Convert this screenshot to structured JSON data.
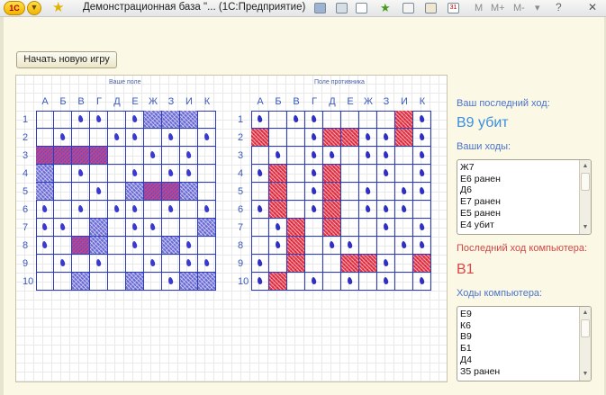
{
  "window": {
    "logo_text": "1С",
    "title": "Демонстрационная база \"...  (1С:Предприятие)",
    "menu_m": "M",
    "menu_mplus": "M+",
    "menu_mminus": "M-",
    "menu_caret": "▾",
    "help": "?",
    "close": "✕"
  },
  "toolbar": {
    "new_game_label": "Начать новую игру"
  },
  "player_field": {
    "label": "Ваше поле"
  },
  "enemy_field": {
    "label": "Поле противника"
  },
  "columns": [
    "А",
    "Б",
    "В",
    "Г",
    "Д",
    "Е",
    "Ж",
    "З",
    "И",
    "К"
  ],
  "rows": [
    "1",
    "2",
    "3",
    "4",
    "5",
    "6",
    "7",
    "8",
    "9",
    "10"
  ],
  "boards": {
    "player": [
      "..mm.msss.",
      ".m..mm.m.m",
      "hhhh..m.m.",
      "s.m..m.mm.",
      "s..m.shhs.",
      "m.m.mm.m.m",
      "mm.s.mm..s",
      "m.hs.m.sm.",
      ".m.m..m.mm",
      "..s..s.mss"
    ],
    "enemy": [
      "m.mm....hm",
      "h..mhhmmhm",
      ".m.mm.mm.m",
      "mh.mh..m.m",
      ".h.mh.m.mm",
      "mh.mh.mmm.",
      ".mh.h..m.m",
      ".mh.mm..mm",
      "m.h..hhm.h",
      "mh.m.m.m.m"
    ]
  },
  "info": {
    "last_move_label": "Ваш последний ход:",
    "last_move_value": "В9 убит",
    "my_moves_label": "Ваши ходы:",
    "my_moves": [
      "Ж7",
      "Е6 ранен",
      "Д6",
      "Е7 ранен",
      "Е5 ранен",
      "Е4 убит"
    ],
    "computer_last_label": "Последний ход компьютера:",
    "computer_last_value": "В1",
    "computer_moves_label": "Ходы компьютера:",
    "computer_moves": [
      "Е9",
      "К6",
      "В9",
      "Б1",
      "Д4",
      "З5 ранен"
    ]
  },
  "colors": {
    "grid_line": "#2c3bb8",
    "miss_mark": "#3a3ad0",
    "ship": "#6a6ad6",
    "hit": "#e8394c",
    "label_blue": "#4a74c9",
    "label_red": "#d64545"
  },
  "icons": {
    "logo": "1c-logo-icon",
    "menu": "dropdown-circle-icon",
    "favorite": "star-icon"
  }
}
